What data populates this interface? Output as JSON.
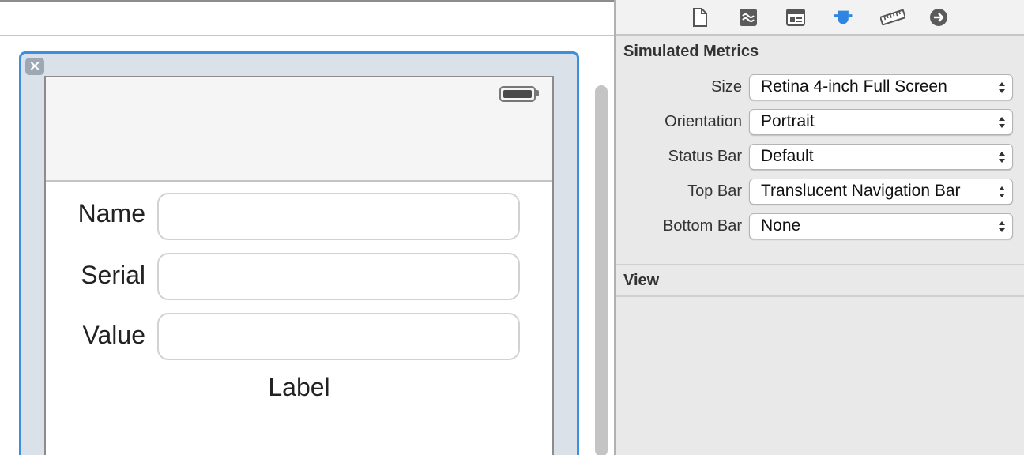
{
  "inspector": {
    "toolbar_icons": [
      "file-icon",
      "quick-help-icon",
      "identity-icon",
      "attributes-icon",
      "size-icon",
      "connections-icon"
    ],
    "active_tab": "attributes-icon",
    "sections": {
      "simulated_metrics": {
        "title": "Simulated Metrics",
        "rows": [
          {
            "label": "Size",
            "value": "Retina 4-inch Full Screen"
          },
          {
            "label": "Orientation",
            "value": "Portrait"
          },
          {
            "label": "Status Bar",
            "value": "Default"
          },
          {
            "label": "Top Bar",
            "value": "Translucent Navigation Bar"
          },
          {
            "label": "Bottom Bar",
            "value": "None"
          }
        ]
      },
      "view": {
        "title": "View"
      }
    }
  },
  "canvas": {
    "form": {
      "fields": [
        {
          "label": "Name"
        },
        {
          "label": "Serial"
        },
        {
          "label": "Value"
        }
      ],
      "label": "Label"
    }
  },
  "colors": {
    "selection": "#3b8fdc",
    "active_icon": "#2f86e0"
  }
}
